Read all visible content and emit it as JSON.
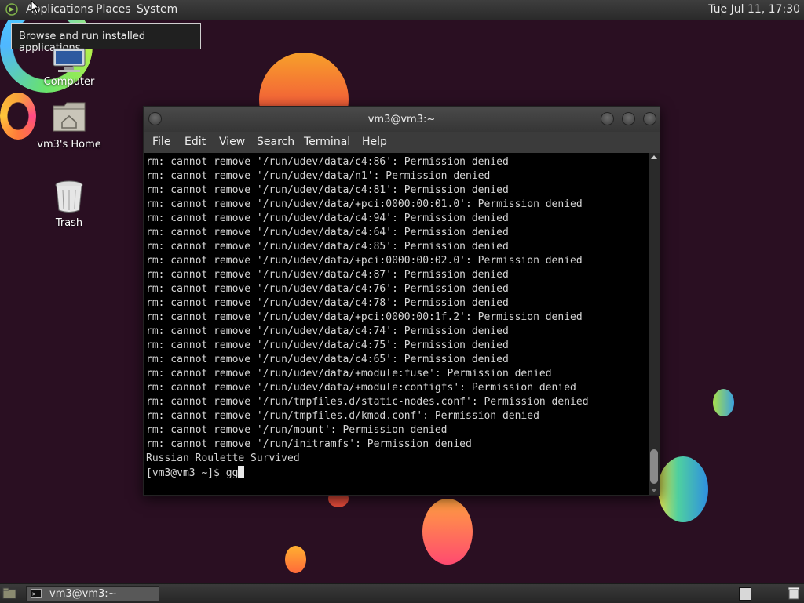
{
  "top_panel": {
    "menus": [
      "Applications",
      "Places",
      "System"
    ],
    "clock": "Tue Jul 11, 17:30"
  },
  "tooltip": {
    "text": "Browse and run installed applications"
  },
  "desktop": {
    "icons": [
      {
        "label": "Computer",
        "icon": "computer-icon"
      },
      {
        "label": "vm3's Home",
        "icon": "home-folder-icon"
      },
      {
        "label": "Trash",
        "icon": "trash-icon"
      }
    ]
  },
  "terminal": {
    "title": "vm3@vm3:~",
    "menu": [
      "File",
      "Edit",
      "View",
      "Search",
      "Terminal",
      "Help"
    ],
    "lines": [
      "rm: cannot remove '/run/udev/data/c4:86': Permission denied",
      "rm: cannot remove '/run/udev/data/n1': Permission denied",
      "rm: cannot remove '/run/udev/data/c4:81': Permission denied",
      "rm: cannot remove '/run/udev/data/+pci:0000:00:01.0': Permission denied",
      "rm: cannot remove '/run/udev/data/c4:94': Permission denied",
      "rm: cannot remove '/run/udev/data/c4:64': Permission denied",
      "rm: cannot remove '/run/udev/data/c4:85': Permission denied",
      "rm: cannot remove '/run/udev/data/+pci:0000:00:02.0': Permission denied",
      "rm: cannot remove '/run/udev/data/c4:87': Permission denied",
      "rm: cannot remove '/run/udev/data/c4:76': Permission denied",
      "rm: cannot remove '/run/udev/data/c4:78': Permission denied",
      "rm: cannot remove '/run/udev/data/+pci:0000:00:1f.2': Permission denied",
      "rm: cannot remove '/run/udev/data/c4:74': Permission denied",
      "rm: cannot remove '/run/udev/data/c4:75': Permission denied",
      "rm: cannot remove '/run/udev/data/c4:65': Permission denied",
      "rm: cannot remove '/run/udev/data/+module:fuse': Permission denied",
      "rm: cannot remove '/run/udev/data/+module:configfs': Permission denied",
      "rm: cannot remove '/run/tmpfiles.d/static-nodes.conf': Permission denied",
      "rm: cannot remove '/run/tmpfiles.d/kmod.conf': Permission denied",
      "rm: cannot remove '/run/mount': Permission denied",
      "rm: cannot remove '/run/initramfs': Permission denied",
      "Russian Roulette Survived"
    ],
    "prompt": "[vm3@vm3 ~]$ ",
    "input": "gg"
  },
  "taskbar": {
    "window_button": "vm3@vm3:~"
  },
  "colors": {
    "desktop_bg": "#2a0f22",
    "terminal_bg": "#000000",
    "terminal_fg": "#d6d6d6"
  }
}
